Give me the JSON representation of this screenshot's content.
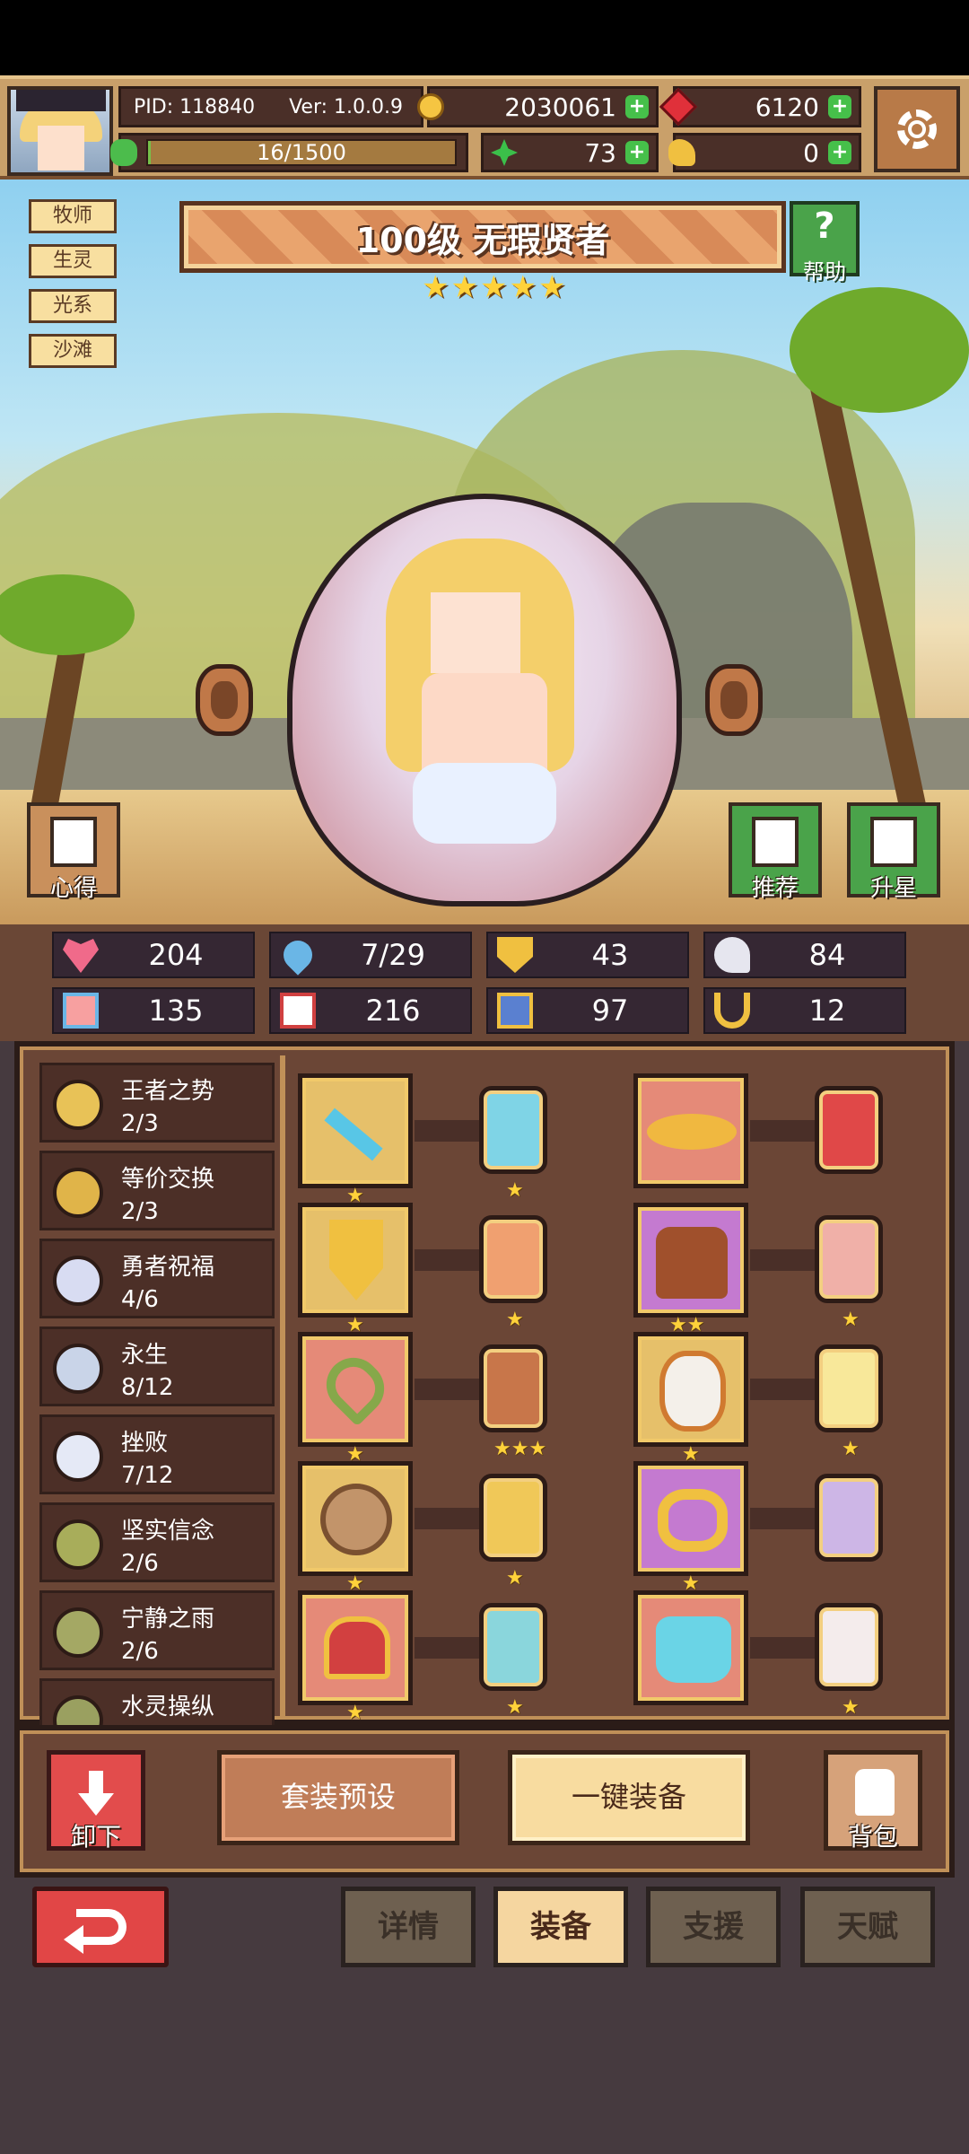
{
  "topbar": {
    "pid": "PID: 118840",
    "version": "Ver: 1.0.0.9",
    "gold": "2030061",
    "rubies": "6120",
    "stamina": "16/1500",
    "clovers": "73",
    "arms": "0"
  },
  "hero": {
    "tags": [
      "牧师",
      "生灵",
      "光系",
      "沙滩"
    ],
    "title": "100级  无瑕贤者",
    "star_count": 5,
    "help_label": "帮助",
    "notes_label": "心得",
    "recommend_label": "推荐",
    "upgrade_star_label": "升星"
  },
  "stats": [
    "204",
    "7/29",
    "43",
    "84",
    "135",
    "216",
    "97",
    "12"
  ],
  "sets": [
    {
      "name": "王者之势",
      "count": "2/3",
      "color": "#e8c257"
    },
    {
      "name": "等价交换",
      "count": "2/3",
      "color": "#e0b449"
    },
    {
      "name": "勇者祝福",
      "count": "4/6",
      "color": "#d8dcf2"
    },
    {
      "name": "永生",
      "count": "8/12",
      "color": "#c9d4e8"
    },
    {
      "name": "挫败",
      "count": "7/12",
      "color": "#e5e9f6"
    },
    {
      "name": "坚实信念",
      "count": "2/6",
      "color": "#a8ad5a"
    },
    {
      "name": "宁静之雨",
      "count": "2/6",
      "color": "#a4a864"
    },
    {
      "name": "水灵操纵",
      "count": "",
      "color": "#9aa060"
    }
  ],
  "actions": {
    "unequip_label": "卸下",
    "preset_label": "套装预设",
    "equip_all_label": "一键装备",
    "bag_label": "背包"
  },
  "nav": {
    "tabs": [
      "详情",
      "装备",
      "支援",
      "天赋"
    ],
    "active": "装备"
  }
}
